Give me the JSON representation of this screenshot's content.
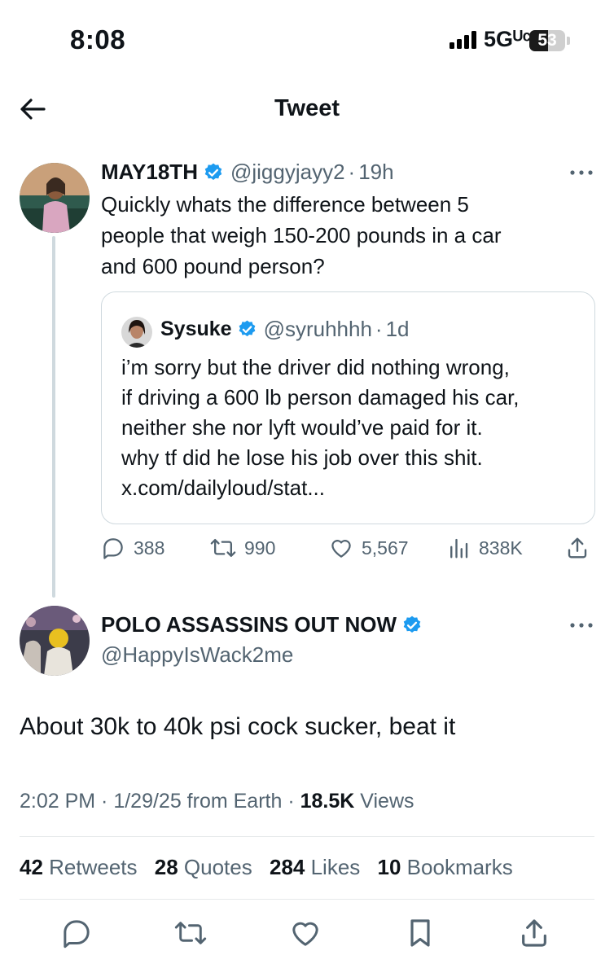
{
  "status_bar": {
    "time": "8:08",
    "network": "5Gᵁᶜ",
    "battery_level": "53",
    "battery_fraction": 0.53
  },
  "nav": {
    "title": "Tweet",
    "back_icon": "arrow-left-icon"
  },
  "original_tweet": {
    "name": "MAY18TH",
    "handle": "@jiggyjayy2",
    "time_ago": "19h",
    "text_lines": [
      "Quickly whats the difference between 5",
      "people that weigh 150-200 pounds in a car",
      "and 600 pound person?"
    ],
    "quote": {
      "name": "Sysuke",
      "handle": "@syruhhhh",
      "time_ago": "1d",
      "text_lines": [
        "i’m sorry but the driver did nothing wrong,",
        "if driving a 600 lb person damaged his car,",
        "neither she nor lyft would’ve paid for it.",
        "why tf did he lose his job over this shit.",
        "x.com/dailyloud/stat..."
      ]
    },
    "actions": {
      "replies": "388",
      "retweets": "990",
      "likes": "5,567",
      "views": "838K"
    }
  },
  "reply_tweet": {
    "name": "POLO ASSASSINS OUT NOW",
    "handle": "@HappyIsWack2me",
    "text": "About 30k to 40k psi cock sucker, beat it",
    "meta_prefix": "2:02 PM · 1/29/25 from Earth · ",
    "views_count": "18.5K",
    "views_label": " Views",
    "stats": {
      "retweets_count": "42",
      "retweets_label": " Retweets",
      "quotes_count": "28",
      "quotes_label": " Quotes",
      "likes_count": "284",
      "likes_label": " Likes",
      "bookmarks_count": "10",
      "bookmarks_label": " Bookmarks"
    }
  },
  "colors": {
    "verified": "#1d9bf0",
    "muted": "#536471",
    "border": "#cfd9de"
  }
}
